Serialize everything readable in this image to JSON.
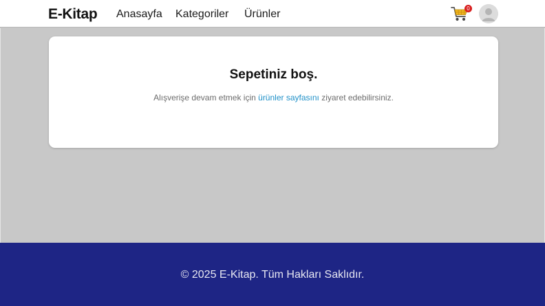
{
  "navbar": {
    "brand": "E-Kitap",
    "links": [
      "Anasayfa",
      "Kategoriler",
      "Ürünler"
    ],
    "cart_count": "0",
    "cart_icon": "shopping-cart-icon",
    "avatar_icon": "user-avatar-icon"
  },
  "cart_empty": {
    "title": "Sepetiniz boş.",
    "text_before": "Alışverişe devam etmek için ",
    "link_text": "ürünler sayfasını",
    "text_after": " ziyaret edebilirsiniz."
  },
  "footer": {
    "text": "© 2025 E-Kitap. Tüm Hakları Saklıdır."
  },
  "colors": {
    "background": "#c8c8c8",
    "footer": "#1e2585",
    "link": "#1d8fc7",
    "badge": "#d81f1f"
  }
}
